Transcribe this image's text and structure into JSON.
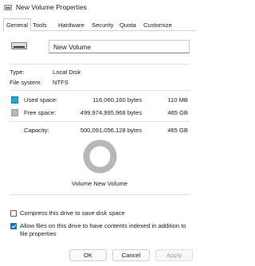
{
  "window": {
    "title": "New Volume Properties"
  },
  "tabs": [
    "General",
    "Tools",
    "Hardware",
    "Security",
    "Quota",
    "Customize"
  ],
  "general": {
    "volume_name": "New Volume",
    "type_label": "Type:",
    "type_value": "Local Disk",
    "fs_label": "File system:",
    "fs_value": "NTFS",
    "used_label": "Used space:",
    "used_bytes": "116,060,160 bytes",
    "used_size": "110 MB",
    "free_label": "Free space:",
    "free_bytes": "499,974,995,968 bytes",
    "free_size": "465 GB",
    "capacity_label": "Capacity:",
    "capacity_bytes": "500,091,056,128 bytes",
    "capacity_size": "465 GB",
    "pie_caption": "Volume New Volume",
    "used_fraction": 0.00023,
    "used_color": "#26a0da",
    "free_color": "#b7b7b7",
    "compress_label": "Compress this drive to save disk space",
    "compress_checked": false,
    "index_label_line1": "Allow files on this drive to have contents indexed in addition to",
    "index_label_line2": "file properties",
    "index_checked": true
  },
  "buttons": {
    "ok": "OK",
    "cancel": "Cancel",
    "apply": "Apply"
  },
  "icons": {
    "title": "drive-icon",
    "volume": "drive-icon"
  }
}
